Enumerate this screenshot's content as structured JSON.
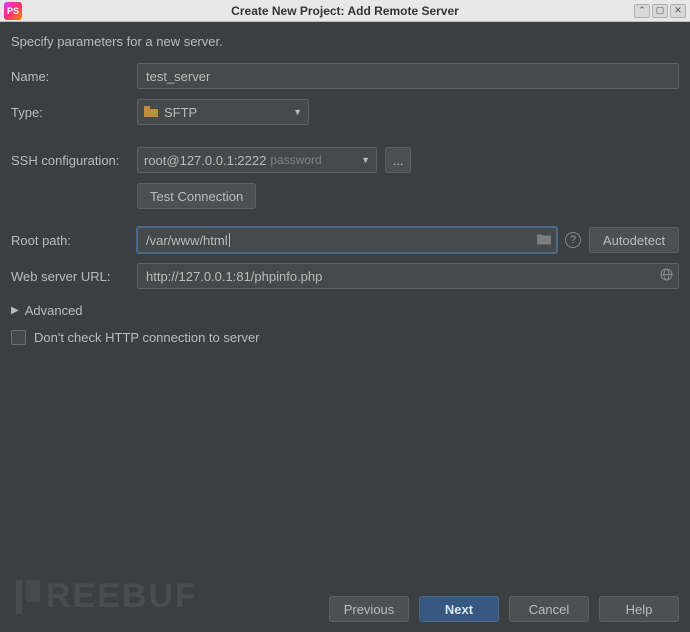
{
  "window": {
    "title": "Create New Project: Add Remote Server"
  },
  "description": "Specify parameters for a new server.",
  "labels": {
    "name": "Name:",
    "type": "Type:",
    "ssh_config": "SSH configuration:",
    "root_path": "Root path:",
    "web_url": "Web server URL:"
  },
  "values": {
    "name": "test_server",
    "type": "SFTP",
    "ssh_host": "root@127.0.0.1:2222",
    "ssh_auth_hint": "password",
    "root_path": "/var/www/html",
    "web_url": "http://127.0.0.1:81/phpinfo.php"
  },
  "buttons": {
    "browse_ssh": "...",
    "test_connection": "Test Connection",
    "autodetect": "Autodetect",
    "previous": "Previous",
    "next": "Next",
    "cancel": "Cancel",
    "help": "Help"
  },
  "advanced": {
    "label": "Advanced"
  },
  "checkbox": {
    "dont_check_http": "Don't check HTTP connection to server",
    "checked": false
  },
  "colors": {
    "bg": "#3c3f41",
    "text": "#bbbbbb",
    "input_bg": "#45494a",
    "border": "#5e6060",
    "primary": "#365880"
  },
  "watermark": "REEBUF"
}
